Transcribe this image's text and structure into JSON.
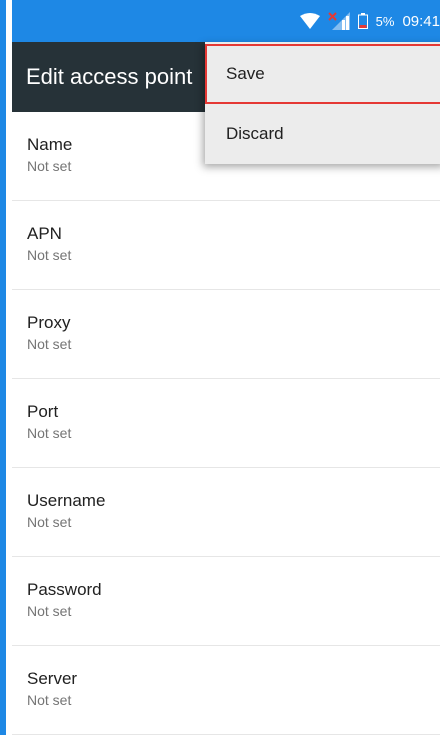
{
  "status_bar": {
    "battery_percent": "5%",
    "time": "09:41",
    "colors": {
      "background": "#1e88e5"
    }
  },
  "toolbar": {
    "title": "Edit access point",
    "background": "#263238"
  },
  "menu": {
    "items": [
      {
        "label": "Save",
        "highlighted": true
      },
      {
        "label": "Discard"
      }
    ]
  },
  "fields": [
    {
      "title": "Name",
      "summary": "Not set"
    },
    {
      "title": "APN",
      "summary": "Not set"
    },
    {
      "title": "Proxy",
      "summary": "Not set"
    },
    {
      "title": "Port",
      "summary": "Not set"
    },
    {
      "title": "Username",
      "summary": "Not set"
    },
    {
      "title": "Password",
      "summary": "Not set"
    },
    {
      "title": "Server",
      "summary": "Not set"
    }
  ],
  "icons": [
    "wifi-icon",
    "no-signal-icon",
    "battery-low-icon"
  ]
}
